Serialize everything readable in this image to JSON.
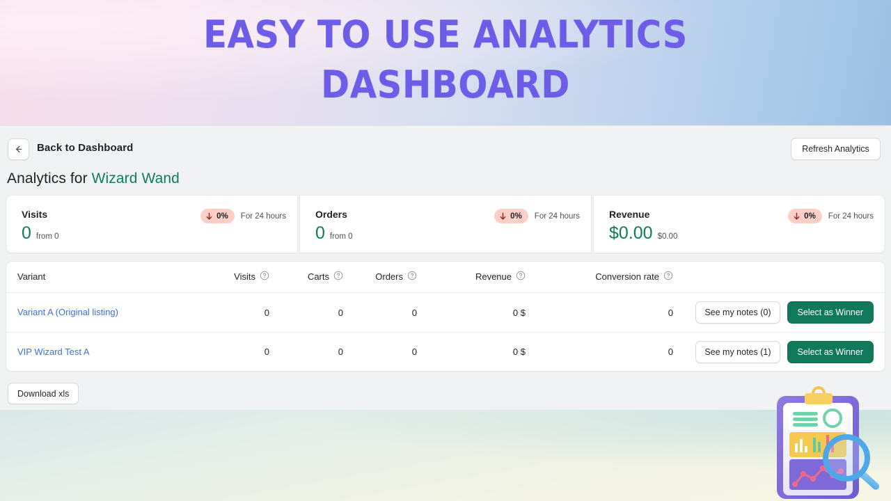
{
  "banner": {
    "line1": "EASY TO USE ANALYTICS",
    "line2": "DASHBOARD",
    "text_color": "#6c5ce7"
  },
  "header": {
    "back_icon": "arrow-left-icon",
    "back_label": "Back to Dashboard",
    "refresh_label": "Refresh Analytics"
  },
  "page": {
    "title_prefix": "Analytics for ",
    "title_brand": "Wizard Wand",
    "brand_color": "#0f7c57"
  },
  "stats": [
    {
      "title": "Visits",
      "value": "0",
      "sub": "from 0",
      "badge": "0%",
      "badge_direction": "down",
      "badge_bg": "#fbcfc8",
      "badge_arrow_color": "#8c1f18",
      "period": "For 24 hours"
    },
    {
      "title": "Orders",
      "value": "0",
      "sub": "from 0",
      "badge": "0%",
      "badge_direction": "down",
      "badge_bg": "#fbcfc8",
      "badge_arrow_color": "#8c1f18",
      "period": "For 24 hours"
    },
    {
      "title": "Revenue",
      "value": "$0.00",
      "sub": "$0.00",
      "badge": "0%",
      "badge_direction": "down",
      "badge_bg": "#fbcfc8",
      "badge_arrow_color": "#8c1f18",
      "period": "For 24 hours"
    }
  ],
  "table": {
    "columns": [
      {
        "label": "Variant",
        "help": false
      },
      {
        "label": "Visits",
        "help": true
      },
      {
        "label": "Carts",
        "help": true
      },
      {
        "label": "Orders",
        "help": true
      },
      {
        "label": "Revenue",
        "help": true
      },
      {
        "label": "Conversion rate",
        "help": true
      }
    ],
    "rows": [
      {
        "variant": "Variant A (Original listing)",
        "visits": "0",
        "carts": "0",
        "orders": "0",
        "revenue": "0 $",
        "conversion": "0",
        "notes_label": "See my notes (0)",
        "winner_label": "Select as Winner"
      },
      {
        "variant": "VIP Wizard Test A",
        "visits": "0",
        "carts": "0",
        "orders": "0",
        "revenue": "0 $",
        "conversion": "0",
        "notes_label": "See my notes (1)",
        "winner_label": "Select as Winner"
      }
    ],
    "link_color": "#3f6ed1",
    "winner_button_color": "#11795b"
  },
  "footer_actions": {
    "download_label": "Download xls"
  },
  "illustration": {
    "name": "clipboard-analytics-magnifier-illustration"
  }
}
